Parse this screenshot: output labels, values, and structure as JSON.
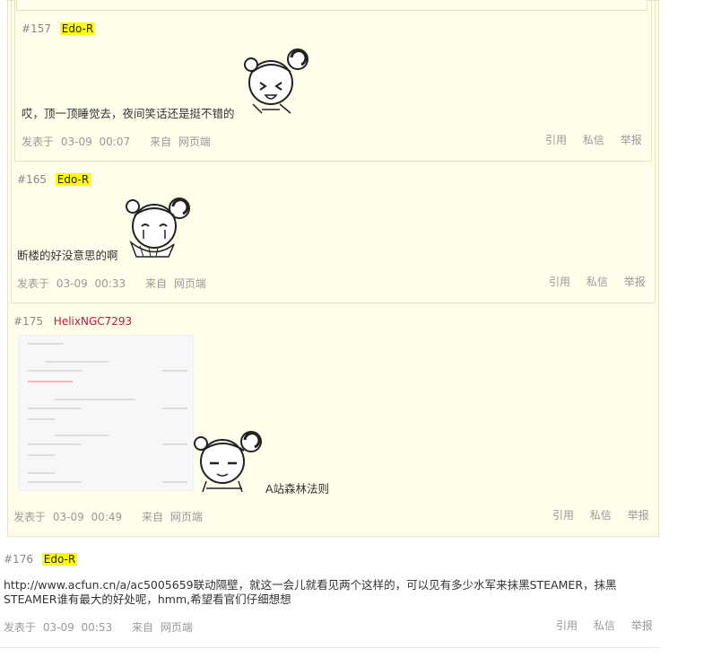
{
  "posts": [
    {
      "floor": "#157",
      "user": "Edo-R",
      "text": "哎，顶一顶睡觉去，夜间笑话还是挺不错的",
      "meta": {
        "label": "发表于",
        "date": "03-09",
        "time": "00:07",
        "from_label": "来自",
        "source": "网页端"
      },
      "actions": [
        "引用",
        "私信",
        "举报"
      ]
    },
    {
      "floor": "#165",
      "user": "Edo-R",
      "text": "断楼的好没意思的啊",
      "meta": {
        "label": "发表于",
        "date": "03-09",
        "time": "00:33",
        "from_label": "来自",
        "source": "网页端"
      },
      "actions": [
        "引用",
        "私信",
        "举报"
      ]
    },
    {
      "floor": "#175",
      "user": "HelixNGC7293",
      "text": "A站森林法则",
      "meta": {
        "label": "发表于",
        "date": "03-09",
        "time": "00:49",
        "from_label": "来自",
        "source": "网页端"
      },
      "actions": [
        "引用",
        "私信",
        "举报"
      ]
    },
    {
      "floor": "#176",
      "user": "Edo-R",
      "text_line1": "http://www.acfun.cn/a/ac5005659联动隔壁，就这一会儿就看见两个这样的，可以见有多少水军来抹黑STEAMER，抹黑",
      "text_line2": "STEAMER谁有最大的好处呢，hmm,希望看官们仔细想想",
      "meta": {
        "label": "发表于",
        "date": "03-09",
        "time": "00:53",
        "from_label": "来自",
        "source": "网页端"
      },
      "actions": [
        "引用",
        "私信",
        "举报"
      ]
    }
  ],
  "colors": {
    "quote_bg": "#fffeea",
    "username_highlight": "#ffff00",
    "username_red": "#d0103a"
  }
}
